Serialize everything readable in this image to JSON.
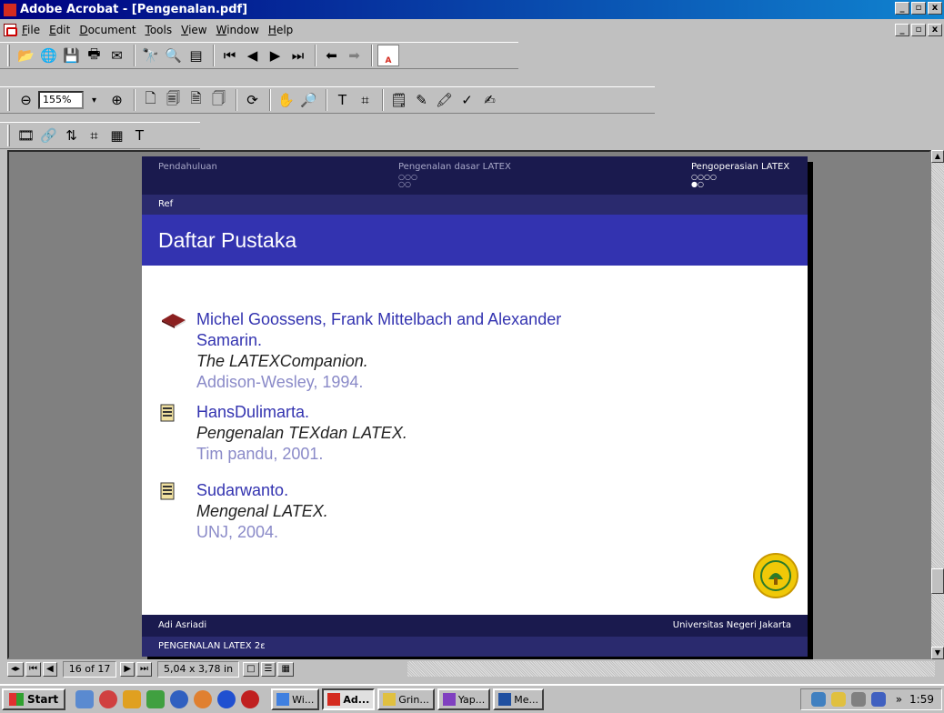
{
  "window": {
    "title": "Adobe Acrobat - [Pengenalan.pdf]",
    "buttons": [
      "_",
      "▫",
      "x"
    ]
  },
  "menu": [
    {
      "label": "File",
      "key": "F"
    },
    {
      "label": "Edit",
      "key": "E"
    },
    {
      "label": "Document",
      "key": "D"
    },
    {
      "label": "Tools",
      "key": "T"
    },
    {
      "label": "View",
      "key": "V"
    },
    {
      "label": "Window",
      "key": "W"
    },
    {
      "label": "Help",
      "key": "H"
    }
  ],
  "toolbar": {
    "zoom": "155%"
  },
  "slide": {
    "nav": [
      {
        "label": "Pendahuluan",
        "dots": ""
      },
      {
        "label": "Pengenalan dasar LATEX",
        "dots": "○○○\n○○"
      },
      {
        "label": "Pengoperasian LATEX",
        "dots": "○○○○\n●○"
      }
    ],
    "subsection": "Ref",
    "frame_title": "Daftar Pustaka",
    "refs": [
      {
        "author": "Michel Goossens, Frank Mittelbach and Alexander",
        "author2": "Samarin.",
        "title": "The LATEXCompanion.",
        "pub": "Addison-Wesley, 1994.",
        "icon": "book-icon"
      },
      {
        "author": "HansDulimarta.",
        "title": "Pengenalan TEXdan LATEX.",
        "pub": "Tim pandu, 2001.",
        "icon": "article-icon"
      },
      {
        "author": "Sudarwanto.",
        "title": "Mengenal LATEX.",
        "pub": "UNJ, 2004.",
        "icon": "article-icon"
      }
    ],
    "footer_author": "Adi Asriadi",
    "footer_institution": "Universitas Negeri Jakarta",
    "footer_title": "PENGENALAN LATEX 2ε"
  },
  "status": {
    "page": "16 of 17",
    "size": "5,04 x 3,78 in"
  },
  "taskbar": {
    "start": "Start",
    "tasks": [
      "Wi...",
      "Ad...",
      "Grin...",
      "Yap...",
      "Me..."
    ],
    "active_task": "Ad...",
    "clock": "1:59"
  },
  "colors": {
    "title_bar": "#000080",
    "slide_header": "#1a1a4e",
    "frame_title_bg": "#3333b0",
    "author": "#3333b0",
    "publisher": "#8a8ac8"
  }
}
